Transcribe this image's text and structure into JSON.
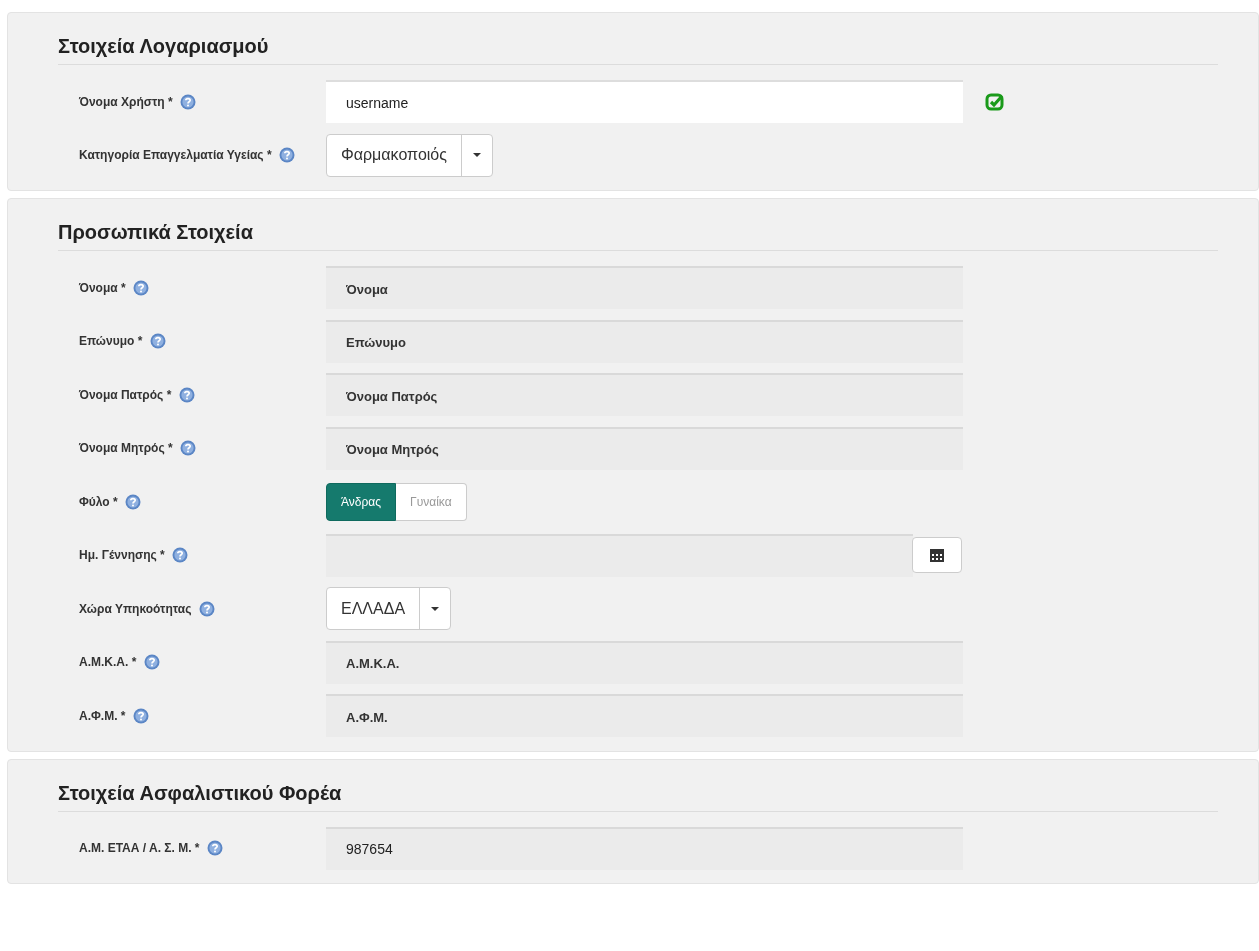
{
  "sections": [
    {
      "title": "Στοιχεία Λογαριασμού",
      "fields": [
        {
          "kind": "text",
          "label": "Όνομα Χρήστη *",
          "value": "username",
          "valid": true
        },
        {
          "kind": "select",
          "label": "Κατηγορία Επαγγελματία Υγείας *",
          "value": "Φαρμακοποιός"
        }
      ]
    },
    {
      "title": "Προσωπικά Στοιχεία",
      "fields": [
        {
          "kind": "readonly",
          "label": "Όνομα *",
          "placeholder": "Όνομα"
        },
        {
          "kind": "readonly",
          "label": "Επώνυμο *",
          "placeholder": "Επώνυμο"
        },
        {
          "kind": "readonly",
          "label": "Όνομα Πατρός *",
          "placeholder": "Όνομα Πατρός"
        },
        {
          "kind": "readonly",
          "label": "Όνομα Μητρός *",
          "placeholder": "Όνομα Μητρός"
        },
        {
          "kind": "toggle",
          "label": "Φύλο *",
          "options": [
            {
              "label": "Άνδρας",
              "selected": true
            },
            {
              "label": "Γυναίκα",
              "selected": false
            }
          ]
        },
        {
          "kind": "date",
          "label": "Ημ. Γέννησης *"
        },
        {
          "kind": "select",
          "label": "Χώρα Υπηκοότητας",
          "value": "ΕΛΛΑΔΑ"
        },
        {
          "kind": "readonly",
          "label": "Α.Μ.Κ.Α. *",
          "placeholder": "Α.Μ.Κ.Α."
        },
        {
          "kind": "readonly",
          "label": "Α.Φ.Μ. *",
          "placeholder": "Α.Φ.Μ."
        }
      ]
    },
    {
      "title": "Στοιχεία Ασφαλιστικού Φορέα",
      "fields": [
        {
          "kind": "readonly",
          "label": "Α.Μ. ΕΤΑΑ / Α. Σ. Μ. *",
          "value": "987654"
        }
      ]
    }
  ]
}
